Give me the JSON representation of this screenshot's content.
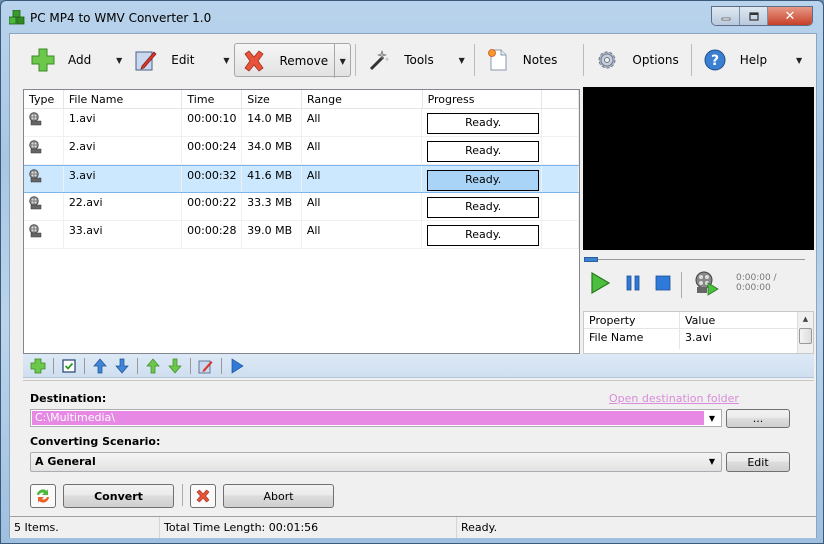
{
  "window": {
    "title": "PC MP4 to WMV Converter 1.0",
    "controls": {
      "minimize": "minimize",
      "maximize": "maximize",
      "close": "close"
    }
  },
  "toolbar": {
    "items": [
      {
        "label": "Add",
        "icon": "add-icon",
        "has_dropdown": true
      },
      {
        "label": "Edit",
        "icon": "edit-icon",
        "has_dropdown": true
      },
      {
        "label": "Remove",
        "icon": "remove-icon",
        "has_dropdown": true,
        "pressed": true
      },
      {
        "label": "Tools",
        "icon": "wand-icon",
        "has_dropdown": true
      },
      {
        "label": "Notes",
        "icon": "notes-icon",
        "has_dropdown": false
      },
      {
        "label": "Options",
        "icon": "gear-icon",
        "has_dropdown": false
      },
      {
        "label": "Help",
        "icon": "help-icon",
        "has_dropdown": true
      }
    ]
  },
  "file_list": {
    "columns": [
      "Type",
      "File Name",
      "Time",
      "Size",
      "Range",
      "Progress"
    ],
    "rows": [
      {
        "file_name": "1.avi",
        "time": "00:00:10",
        "size": "14.0 MB",
        "range": "All",
        "progress": "Ready.",
        "selected": false
      },
      {
        "file_name": "2.avi",
        "time": "00:00:24",
        "size": "34.0 MB",
        "range": "All",
        "progress": "Ready.",
        "selected": false
      },
      {
        "file_name": "3.avi",
        "time": "00:00:32",
        "size": "41.6 MB",
        "range": "All",
        "progress": "Ready.",
        "selected": true
      },
      {
        "file_name": "22.avi",
        "time": "00:00:22",
        "size": "33.3 MB",
        "range": "All",
        "progress": "Ready.",
        "selected": false
      },
      {
        "file_name": "33.avi",
        "time": "00:00:28",
        "size": "39.0 MB",
        "range": "All",
        "progress": "Ready.",
        "selected": false
      }
    ]
  },
  "player": {
    "seek_position": 0,
    "time_display": "0:00:00 / 0:00:00"
  },
  "properties": {
    "columns": [
      "Property",
      "Value"
    ],
    "rows": [
      {
        "property": "File Name",
        "value": "3.avi"
      }
    ]
  },
  "mini_toolbar": {
    "buttons": [
      "add",
      "check-all",
      "move-up",
      "move-down",
      "move-top",
      "move-bottom",
      "edit",
      "play"
    ]
  },
  "destination": {
    "label": "Destination:",
    "value": "C:\\Multimedia\\",
    "open_folder_link": "Open destination folder",
    "browse_label": "...",
    "highlight_color": "#e688e4"
  },
  "scenario": {
    "label": "Converting Scenario:",
    "value": "A General",
    "edit_label": "Edit"
  },
  "actions": {
    "convert_label": "Convert",
    "abort_label": "Abort"
  },
  "status": {
    "items": "5 Items.",
    "total_time": "Total Time Length: 00:01:56",
    "state": "Ready."
  }
}
